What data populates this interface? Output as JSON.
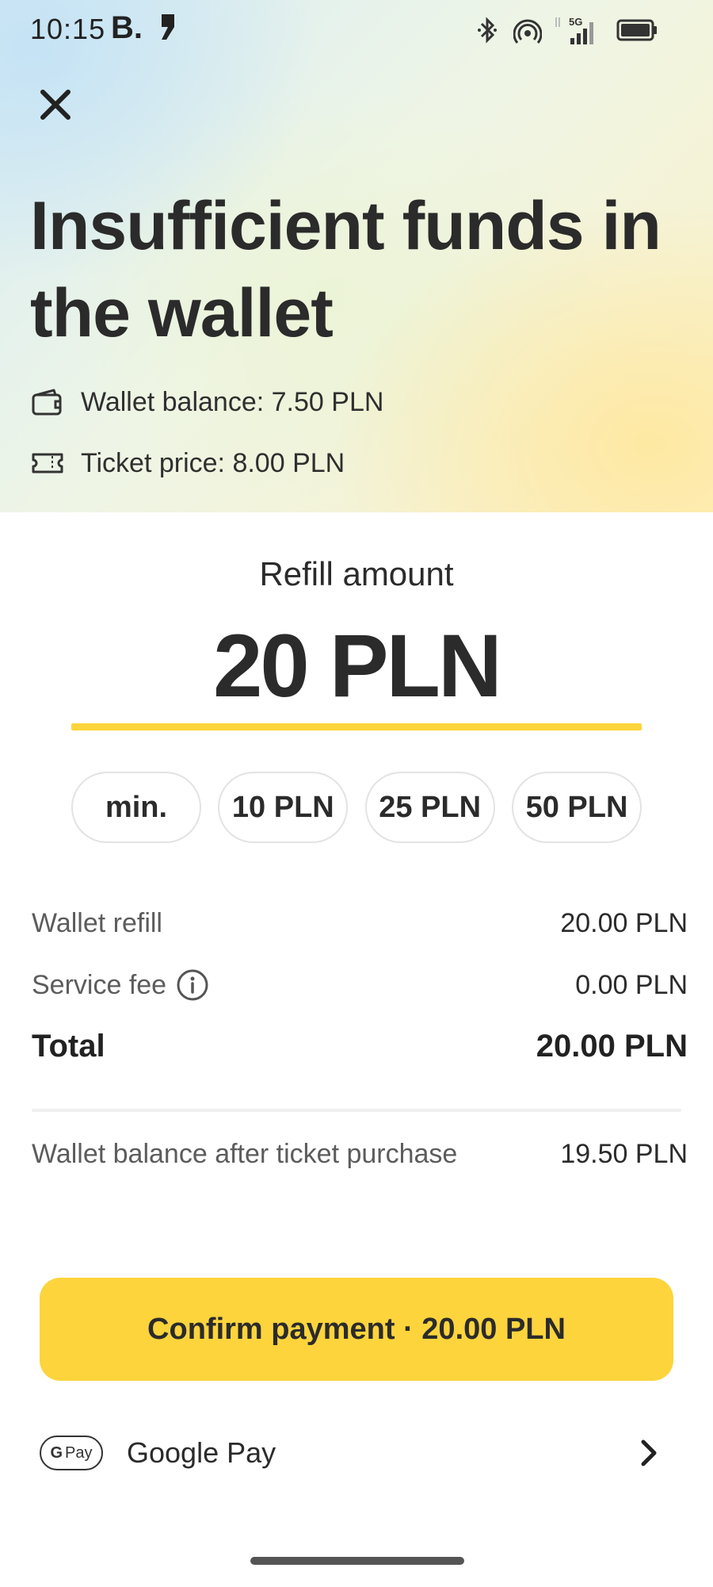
{
  "status_bar": {
    "time": "10:15",
    "brand_letter": "B.",
    "network": "5G"
  },
  "header": {
    "title": "Insufficient funds in the wallet",
    "wallet_balance": "Wallet balance: 7.50 PLN",
    "ticket_price": "Ticket price: 8.00 PLN"
  },
  "refill": {
    "label": "Refill amount",
    "amount": "20 PLN",
    "options": [
      "min.",
      "10 PLN",
      "25 PLN",
      "50 PLN"
    ]
  },
  "summary": {
    "wallet_refill_label": "Wallet refill",
    "wallet_refill_value": "20.00 PLN",
    "service_fee_label": "Service fee",
    "service_fee_value": "0.00 PLN",
    "total_label": "Total",
    "total_value": "20.00 PLN",
    "balance_after_label": "Wallet balance after ticket purchase",
    "balance_after_value": "19.50 PLN"
  },
  "actions": {
    "confirm_label": "Confirm payment · 20.00 PLN",
    "payment_method": "Google Pay",
    "gpay_badge": "Pay",
    "gpay_badge_g": "G"
  },
  "colors": {
    "accent": "#fdd43c",
    "text": "#2b2b2b"
  }
}
